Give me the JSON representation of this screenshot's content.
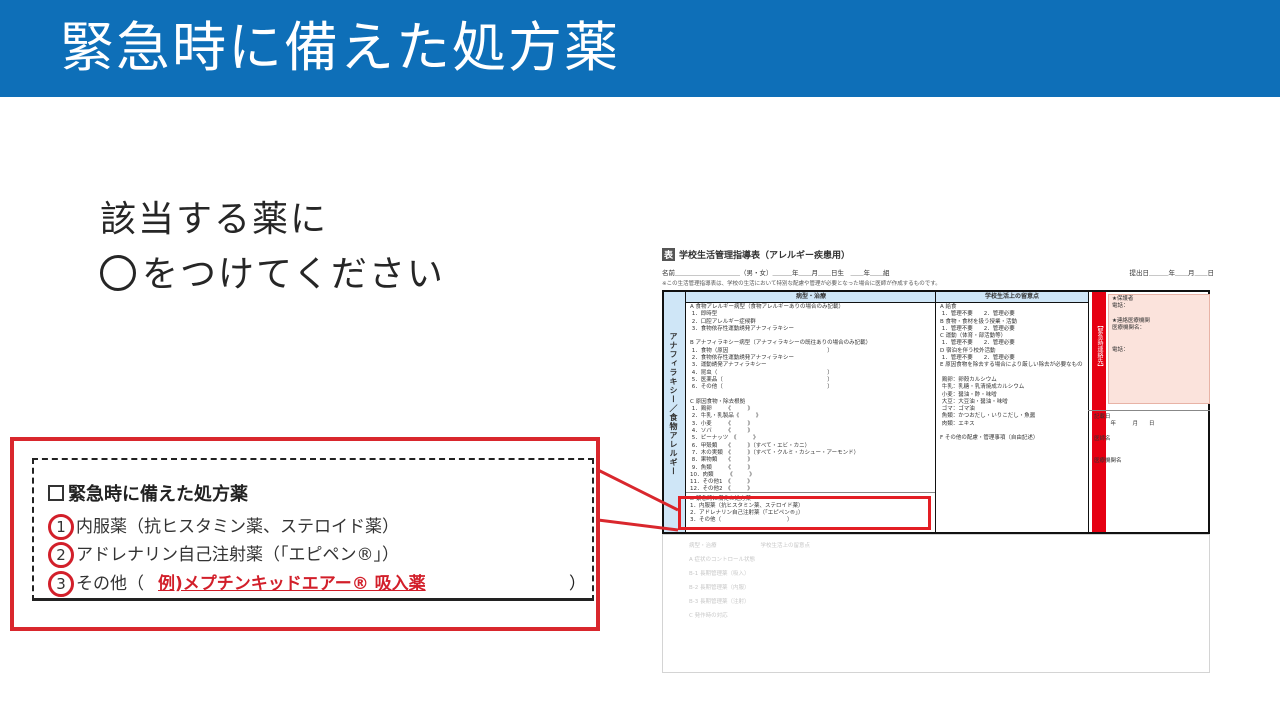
{
  "slide": {
    "title": "緊急時に備えた処方薬",
    "instruction_line1": "該当する薬に",
    "instruction_line2": "をつけてください"
  },
  "form": {
    "tag": "表",
    "title": "学校生活管理指導表（アレルギー疾患用）",
    "name_line": "名前＿＿＿＿＿＿＿＿＿＿（男・女）＿＿＿年＿＿月＿＿日生　＿＿年＿＿組",
    "submit_line": "提出日＿＿＿年＿＿月＿＿日",
    "note": "※この生活管理指導表は、学校の生活において特別な配慮や管理が必要となった場合に医師が作成するものです。",
    "side_label": "アナフィラキシー／食物アレルギー",
    "col_disease": "病型・治療",
    "col_school": "学校生活上の留意点",
    "contact_label": "【緊急時連絡先】",
    "left_text": "A 食物アレルギー病型（食物アレルギーありの場合のみ記載）\n 1．即時型\n 2．口腔アレルギー症候群\n 3．食物依存性運動誘発アナフィラキシー\n\nB アナフィラキシー病型（アナフィラキシーの既往ありの場合のみ記載）\n 1．食物（原因　　　　　　　　　　　　　　　　　　）\n 2．食物依存性運動誘発アナフィラキシー\n 3．運動誘発アナフィラキシー\n 4．昆虫（　　　　　　　　　　　　　　　　　　　　）\n 5．医薬品（　　　　　　　　　　　　　　　　　　　）\n 6．その他（　　　　　　　　　　　　　　　　　　　）\n\nC 原因食物・除去根拠\n 1．鶏卵　　　《　　　》\n 2．牛乳・乳製品《　　　》\n 3．小麦　　　《　　　》\n 4．ソバ　　　《　　　》\n 5．ピーナッツ　《　　　》\n 6．甲殻類　　《　　　》（すべて・エビ・カニ）\n 7．木の実類　《　　　》（すべて・クルミ・カシュー・アーモンド）\n 8．果物類　　《　　　》\n 9．魚類　　　《　　　》\n10．肉類　　　《　　　》\n11．その他1　《　　　》\n12．その他2　《　　　》",
    "form_d_title": "D 緊急時に備えた処方薬",
    "form_d_1": "1．内服薬（抗ヒスタミン薬、ステロイド薬）",
    "form_d_2": "2．アドレナリン自己注射薬（「エピペン®」）",
    "form_d_3": "3．その他（　　　　　　　　　　　　）",
    "right_text": "A 給食\n 1．管理不要　　2．管理必要\nB 食物・食材を扱う授業・活動\n 1．管理不要　　2．管理必要\nC 運動（体育・部活動等）\n 1．管理不要　　2．管理必要\nD 宿泊を伴う校外活動\n 1．管理不要　　2．管理必要\nE 原因食物を除去する場合により厳しい除去が必要なもの\n\n 鶏卵：卵殻カルシウム\n 牛乳：乳糖・乳清焼成カルシウム\n 小麦：醤油・酢・味噌\n 大豆：大豆油・醤油・味噌\n ゴマ：ゴマ油\n 魚類：かつおだし・いりこだし・魚醤\n 肉類：エキス\n\nF その他の配慮・管理事項（自由記述）",
    "contact_text": "★保護者\n電話：\n\n★連絡医療機関\n医療機関名：\n\n\n電話：",
    "date_text": "記載日\n　　　年　　　月　　日\n\n医師名\n\n\n医療機関名",
    "faded_text": "病型・治療　　　　　　　　学校生活上の留意点\nA 症状のコントロール状態\nB-1 長期管理薬（吸入）\nB-2 長期管理薬（内服）\nB-3 長期管理薬（注射）\nC 発作時の対応"
  },
  "callout": {
    "title": "緊急時に備えた処方薬",
    "item1_num": "1",
    "item1": "内服薬（抗ヒスタミン薬、ステロイド薬）",
    "item2_num": "2",
    "item2": "アドレナリン自己注射薬（「エピペン®」）",
    "item3_num": "3",
    "item3": "その他（",
    "item3_example": "例)メプチンキッドエアー® 吸入薬",
    "item3_close": "）"
  },
  "colors": {
    "header": "#0e6fb8",
    "highlight": "#e31e24",
    "example_text": "#d21f2a"
  }
}
